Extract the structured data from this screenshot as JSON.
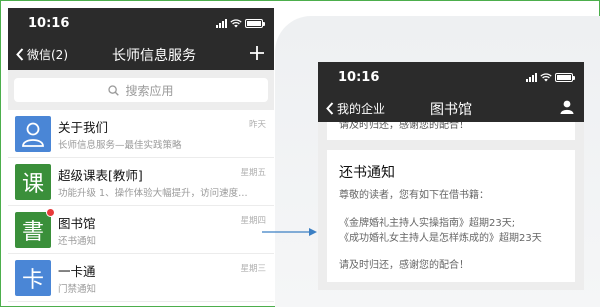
{
  "left_screen": {
    "status_time": "10:16",
    "back_label": "微信(2)",
    "title": "长师信息服务",
    "search_placeholder": "搜索应用",
    "items": [
      {
        "name": "关于我们",
        "subtitle": "长师信息服务—最佳实践策略",
        "time": "昨天",
        "icon": "person-icon",
        "color": "#4a86d6"
      },
      {
        "name": "超级课表[教师]",
        "subtitle": "功能升级 1、操作体验大幅提升，访问速度…",
        "time": "星期五",
        "icon_char": "课",
        "color": "#3a8f3a"
      },
      {
        "name": "图书馆",
        "subtitle": "还书通知",
        "time": "星期四",
        "icon_char": "書",
        "color": "#3a8f3a",
        "unread": true
      },
      {
        "name": "一卡通",
        "subtitle": "门禁通知",
        "time": "星期三",
        "icon_char": "卡",
        "color": "#4a86d6"
      }
    ]
  },
  "right_screen": {
    "status_time": "10:16",
    "back_label": "我的企业",
    "title": "图书馆",
    "previous_message_fragment": "请及时归还，感谢您的配合！",
    "card": {
      "title": "还书通知",
      "greeting": "尊敬的读者，您有如下在借书籍：",
      "books": [
        "《金牌婚礼主持人实操指南》超期23天;",
        "《成功婚礼女主持人是怎样炼成的》超期23天"
      ],
      "closing": "请及时归还，感谢您的配合！"
    }
  },
  "colors": {
    "header_bg": "#2b2b2b",
    "list_bg": "#ededed",
    "arrow": "#3b7fc4",
    "frame": "#4cae4c",
    "unread_dot": "#e83a3a"
  }
}
